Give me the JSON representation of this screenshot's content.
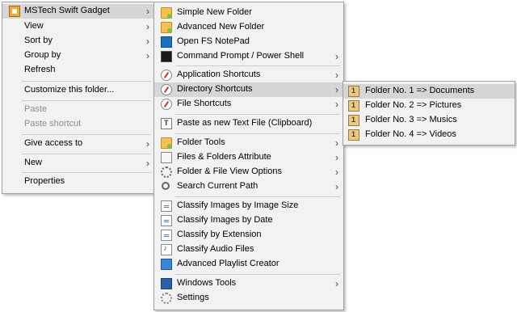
{
  "menu1": {
    "items": [
      {
        "label": "MSTech Swift Gadget",
        "icon": "mstech-icon",
        "submenu": true,
        "highlight": true
      },
      {
        "label": "View",
        "submenu": true
      },
      {
        "label": "Sort by",
        "submenu": true
      },
      {
        "label": "Group by",
        "submenu": true
      },
      {
        "label": "Refresh"
      },
      {
        "label": "Customize this folder..."
      },
      {
        "label": "Paste",
        "disabled": true
      },
      {
        "label": "Paste shortcut",
        "disabled": true
      },
      {
        "label": "Give access to",
        "submenu": true
      },
      {
        "label": "New",
        "submenu": true
      },
      {
        "label": "Properties"
      }
    ]
  },
  "menu2": {
    "items": [
      {
        "label": "Simple New Folder",
        "icon": "folder-add-icon"
      },
      {
        "label": "Advanced New Folder",
        "icon": "folder-add-icon"
      },
      {
        "label": "Open FS NotePad",
        "icon": "notepad-icon"
      },
      {
        "label": "Command Prompt / Power Shell",
        "icon": "terminal-icon",
        "submenu": true
      },
      {
        "label": "Application Shortcuts",
        "icon": "compass-icon",
        "submenu": true
      },
      {
        "label": "Directory Shortcuts",
        "icon": "compass-icon",
        "submenu": true,
        "highlight": true
      },
      {
        "label": "File Shortcuts",
        "icon": "compass-icon",
        "submenu": true
      },
      {
        "label": "Paste as new Text File (Clipboard)",
        "icon": "paste-text-icon"
      },
      {
        "label": "Folder Tools",
        "icon": "folder-icon",
        "submenu": true
      },
      {
        "label": "Files & Folders Attribute",
        "icon": "attribute-icon",
        "submenu": true
      },
      {
        "label": "Folder & File View Options",
        "icon": "gear-icon",
        "submenu": true
      },
      {
        "label": "Search Current Path",
        "icon": "search-icon",
        "submenu": true
      },
      {
        "label": "Classify Images by Image Size",
        "icon": "document-icon"
      },
      {
        "label": "Classify Images by Date",
        "icon": "document-icon"
      },
      {
        "label": "Classify by Extension",
        "icon": "document-icon"
      },
      {
        "label": "Classify Audio Files",
        "icon": "audio-file-icon"
      },
      {
        "label": "Advanced Playlist Creator",
        "icon": "playlist-icon"
      },
      {
        "label": "Windows Tools",
        "icon": "windows-icon",
        "submenu": true
      },
      {
        "label": "Settings",
        "icon": "settings-gear-icon"
      }
    ]
  },
  "menu3": {
    "items": [
      {
        "label": "Folder No. 1 => Documents",
        "icon": "folder-number-icon",
        "highlight": true
      },
      {
        "label": "Folder No. 2 => Pictures",
        "icon": "folder-number-icon"
      },
      {
        "label": "Folder No. 3 => Musics",
        "icon": "folder-number-icon"
      },
      {
        "label": "Folder No. 4 => Videos",
        "icon": "folder-number-icon"
      }
    ]
  },
  "glyphs": {
    "submenu_arrow": "›"
  }
}
